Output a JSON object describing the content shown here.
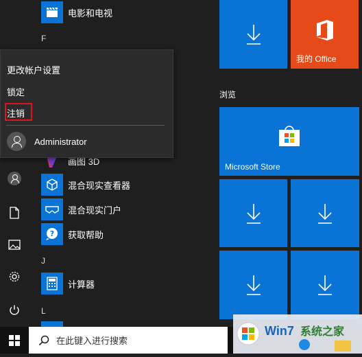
{
  "context_menu": {
    "items": [
      "更改帐户设置",
      "锁定",
      "注销"
    ],
    "user_name": "Administrator"
  },
  "app_list": {
    "top_app": "电影和电视",
    "letter_f": "F",
    "partial_app": "画图 3D",
    "apps": [
      "混合现实查看器",
      "混合现实门户",
      "获取帮助"
    ],
    "letter_j": "J",
    "calculator": "计算器",
    "letter_l": "L"
  },
  "tiles": {
    "office_label": "我的 Office",
    "group_browse": "浏览",
    "store_label": "Microsoft Store"
  },
  "taskbar": {
    "search_placeholder": "在此键入进行搜索"
  },
  "watermark": {
    "text_a": "Win7",
    "text_b": "系统之家"
  },
  "colors": {
    "tile_blue": "#0a74d6",
    "office_orange": "#e64a19",
    "highlight_red": "#e0141e"
  },
  "icons": [
    "start-icon",
    "user-icon",
    "document-icon",
    "pictures-icon",
    "settings-icon",
    "power-icon",
    "download-icon",
    "office-icon",
    "store-icon",
    "search-icon",
    "movies-icon",
    "3d-icon",
    "mixed-reality-viewer-icon",
    "mixed-reality-portal-icon",
    "help-icon",
    "calculator-icon"
  ]
}
